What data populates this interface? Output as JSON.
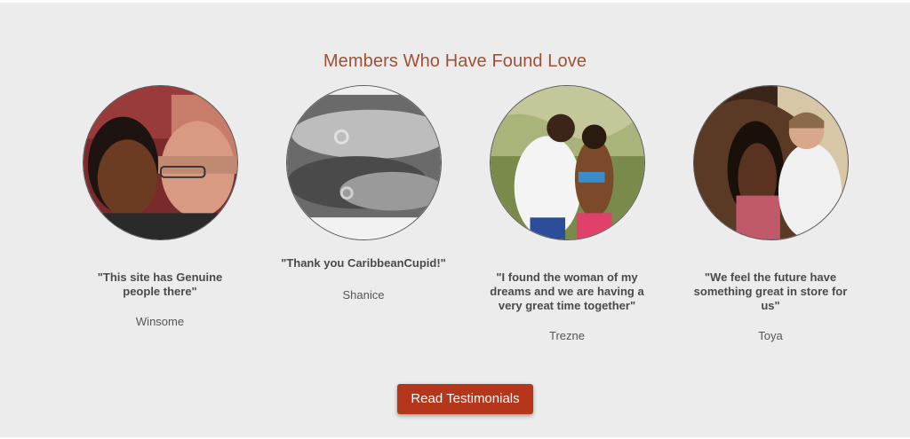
{
  "section": {
    "title": "Members Who Have Found Love"
  },
  "members": [
    {
      "quote": "\"This site has Genuine people there\"",
      "name": "Winsome"
    },
    {
      "quote": "\"Thank you CaribbeanCupid!\"",
      "name": "Shanice"
    },
    {
      "quote": "\"I found the woman of my dreams and we are having a very great time together\"",
      "name": "Trezne"
    },
    {
      "quote": "\"We feel the future have something great in store for us\"",
      "name": "Toya"
    }
  ],
  "cta": {
    "label": "Read Testimonials"
  },
  "colors": {
    "background": "#ececec",
    "title": "#9c5236",
    "button": "#b5361b"
  }
}
